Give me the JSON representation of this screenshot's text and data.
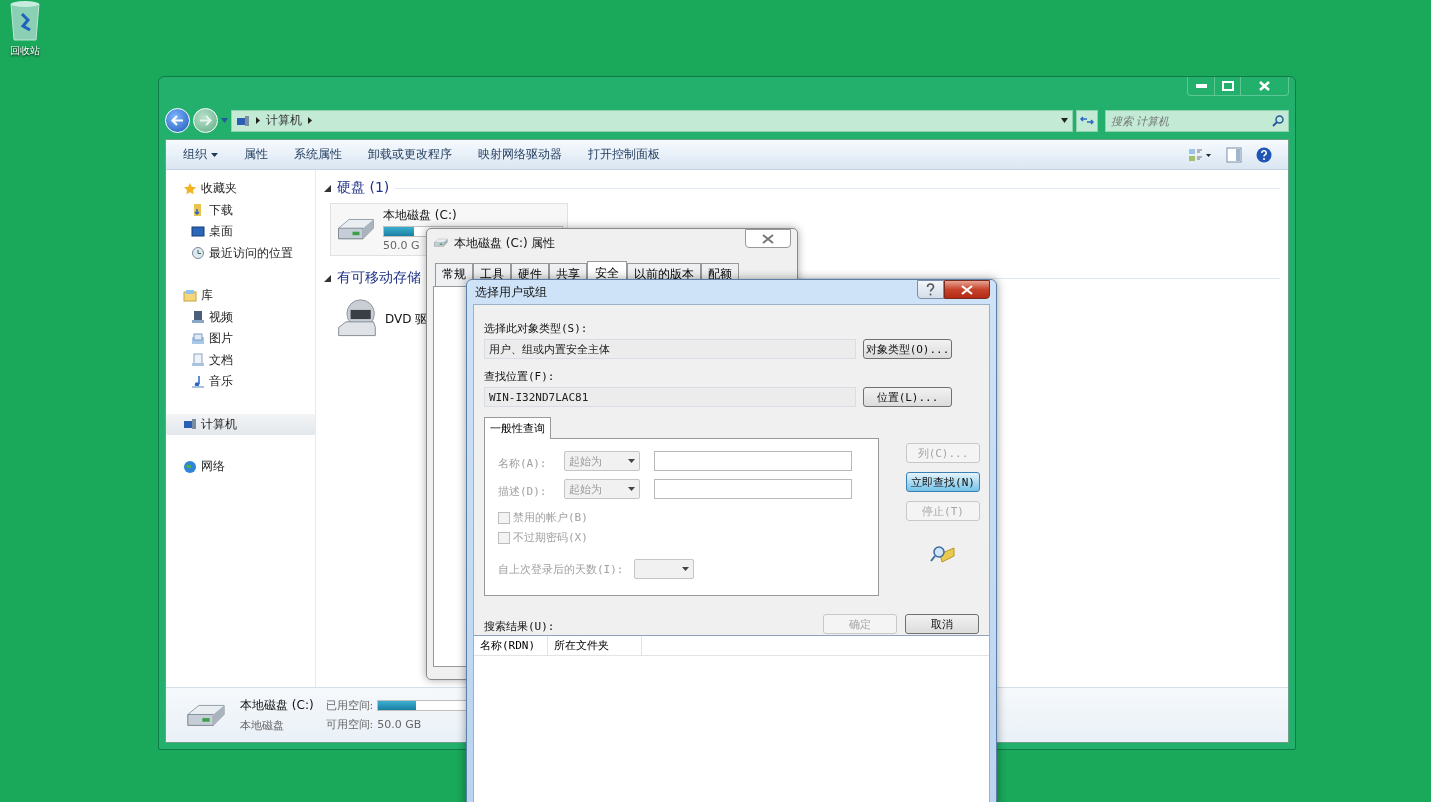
{
  "desktop": {
    "icons": [
      {
        "label": "回收站"
      }
    ]
  },
  "explorer": {
    "address": [
      "计算机"
    ],
    "search": {
      "placeholder": "搜索 计算机"
    },
    "toolbar": [
      {
        "label": "组织",
        "dropdown": true
      },
      {
        "label": "属性",
        "dropdown": false
      },
      {
        "label": "系统属性",
        "dropdown": false
      },
      {
        "label": "卸载或更改程序",
        "dropdown": false
      },
      {
        "label": "映射网络驱动器",
        "dropdown": false
      },
      {
        "label": "打开控制面板",
        "dropdown": false
      }
    ],
    "sidebar": [
      {
        "kind": "favorites",
        "label": "收藏夹",
        "selected": false,
        "children": [
          {
            "kind": "download",
            "label": "下载",
            "selected": false
          },
          {
            "kind": "desktop",
            "label": "桌面",
            "selected": false
          },
          {
            "kind": "recent",
            "label": "最近访问的位置",
            "selected": false
          }
        ]
      },
      {
        "kind": "library",
        "label": "库",
        "selected": false,
        "children": [
          {
            "kind": "video",
            "label": "视频",
            "selected": false
          },
          {
            "kind": "picture",
            "label": "图片",
            "selected": false
          },
          {
            "kind": "document",
            "label": "文档",
            "selected": false
          },
          {
            "kind": "music",
            "label": "音乐",
            "selected": false
          }
        ]
      },
      {
        "kind": "computer",
        "label": "计算机",
        "selected": true
      },
      {
        "kind": "network",
        "label": "网络",
        "selected": false
      }
    ],
    "groups": [
      {
        "title": "硬盘 (1)",
        "items": [
          {
            "kind": "disk",
            "name": "本地磁盘 (C:)",
            "level": 0.17,
            "detail": "50.0 G"
          }
        ]
      },
      {
        "title": "有可移动存储",
        "items": [
          {
            "kind": "dvd",
            "name": "DVD 驱"
          }
        ]
      }
    ],
    "details": {
      "name": "本地磁盘 (C:)",
      "type": "本地磁盘",
      "used_label": "已用空间:",
      "level": 0.27,
      "free_label": "可用空间:",
      "free": "50.0 GB"
    }
  },
  "properties_dialog": {
    "title": "本地磁盘 (C:) 属性",
    "tabs": [
      {
        "label": "常规",
        "selected": false
      },
      {
        "label": "工具",
        "selected": false
      },
      {
        "label": "硬件",
        "selected": false
      },
      {
        "label": "共享",
        "selected": false
      },
      {
        "label": "安全",
        "selected": true
      },
      {
        "label": "以前的版本",
        "selected": false
      },
      {
        "label": "配额",
        "selected": false
      }
    ]
  },
  "select_dialog": {
    "title": "选择用户或组",
    "object_type_label": "选择此对象类型(S):",
    "object_type": "用户、组或内置安全主体",
    "object_type_button": "对象类型(O)...",
    "location_label": "查找位置(F):",
    "location": "WIN-I32ND7LAC81",
    "location_button": "位置(L)...",
    "query_tab": "一般性查询",
    "query_rows": [
      {
        "label": "名称(A):",
        "mode": "起始为"
      },
      {
        "label": "描述(D):",
        "mode": "起始为"
      }
    ],
    "checkboxes": [
      {
        "label": "禁用的帐户(B)",
        "checked": false
      },
      {
        "label": "不过期密码(X)",
        "checked": false
      }
    ],
    "days_label": "自上次登录后的天数(I):",
    "side_buttons": [
      {
        "label": "列(C)...",
        "disabled": true,
        "highlighted": false
      },
      {
        "label": "立即查找(N)",
        "disabled": false,
        "highlighted": true
      },
      {
        "label": "停止(T)",
        "disabled": true,
        "highlighted": false
      }
    ],
    "ok": {
      "label": "确定",
      "disabled": true
    },
    "cancel": {
      "label": "取消",
      "disabled": false
    },
    "results_label": "搜索结果(U):",
    "columns": [
      "名称(RDN)",
      "所在文件夹"
    ]
  }
}
